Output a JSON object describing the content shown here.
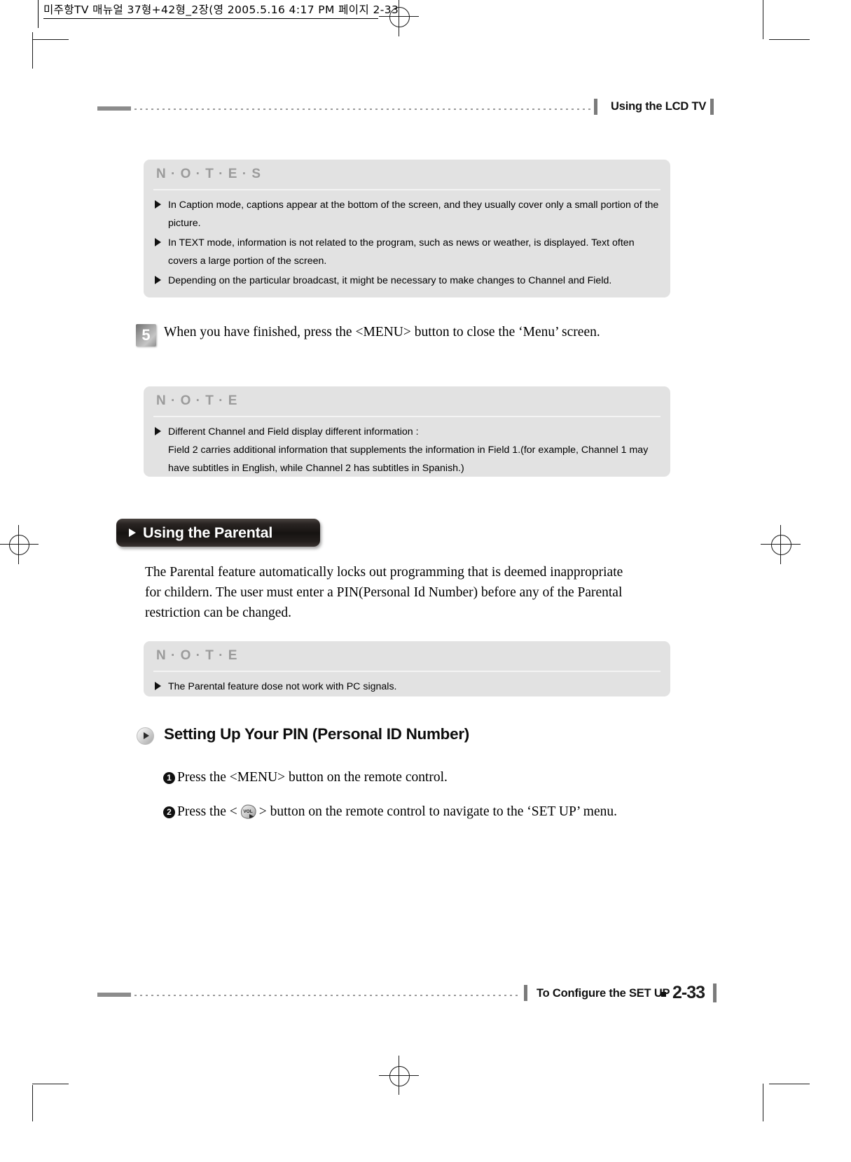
{
  "slug": {
    "text": "미주항TV 매뉴얼 37형+42형_2장(영   2005.5.16 4:17 PM   페이지 2-33"
  },
  "header": {
    "title": "Using the LCD TV"
  },
  "notes_boxes": [
    {
      "title": "N · O · T · E · S",
      "items": [
        "In Caption mode, captions appear at the bottom of the screen, and they usually cover only a small portion of the picture.",
        "In TEXT mode, information is not related to the program, such as news or weather, is displayed. Text often covers a large portion of the screen.",
        "Depending on the particular broadcast, it might be necessary to make changes to Channel and Field."
      ]
    },
    {
      "title": "N · O · T · E",
      "items": [
        "Different Channel and Field display different information :"
      ],
      "sub": "Field 2 carries additional information that supplements the information in Field 1.(for example, Channel 1 may have subtitles in English, while Channel 2 has subtitles in Spanish.)"
    },
    {
      "title": "N · O · T · E",
      "items": [
        "The Parental feature dose not work with PC signals."
      ]
    }
  ],
  "step5": {
    "number": "5",
    "text": "When you have finished, press the <MENU> button to close the ‘Menu’ screen."
  },
  "banner": {
    "label": "Using the Parental",
    "arrow_icon": "triangle-right-icon"
  },
  "body_paragraph": "The Parental feature automatically locks out programming that is deemed inappropriate for childern. The user must enter a PIN(Personal Id Number) before any of the Parental restriction can be changed.",
  "subsection": {
    "icon": "circle-arrow-right-icon",
    "title": "Setting Up Your PIN (Personal ID Number)"
  },
  "numbered_steps": [
    {
      "number": "1",
      "text_before": "Press the <MENU> button on the remote control.",
      "text_after": ""
    },
    {
      "number": "2",
      "text_before": "Press the <",
      "key_icon": "vol-key-icon",
      "key_label": "VOL",
      "text_after": "> button on the remote control to navigate to the ‘SET UP’ menu."
    }
  ],
  "footer": {
    "text": "To Configure the SET UP",
    "page": "2-33"
  },
  "colors": {
    "note_bg": "#e2e2e2",
    "note_title": "#9b9b9b",
    "rule_gray": "#8c8c8c",
    "banner_bg": "#161311",
    "text": "#000000"
  }
}
